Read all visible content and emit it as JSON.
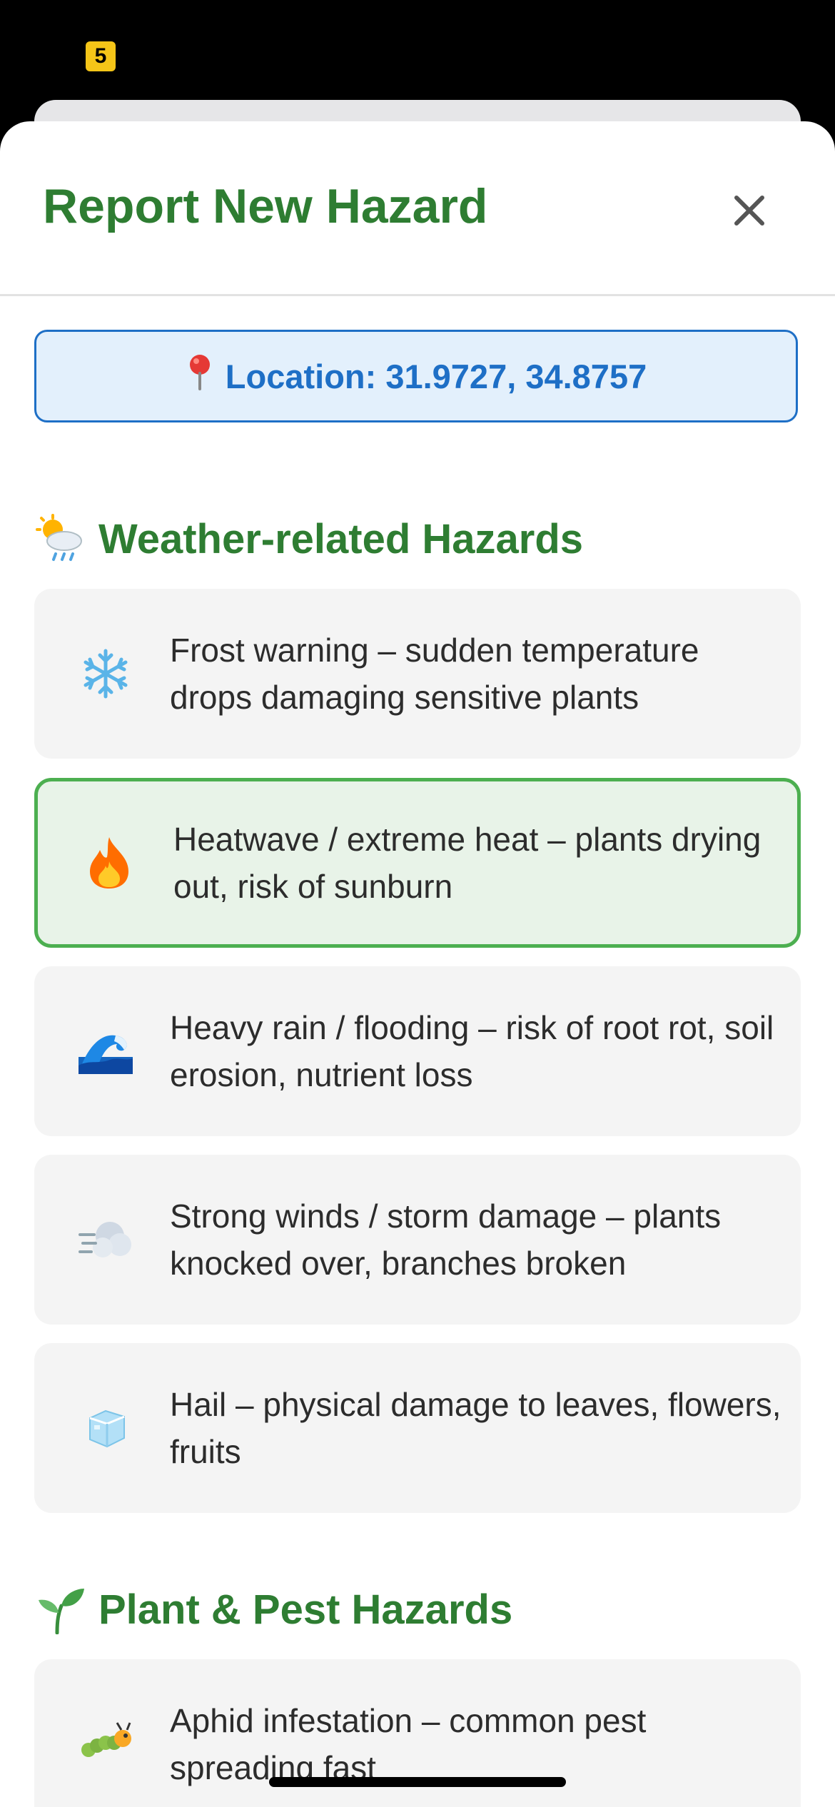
{
  "status_bar": {
    "badge": "5"
  },
  "modal": {
    "title": "Report New Hazard",
    "location_label": "Location: 31.9727, 34.8757"
  },
  "sections": [
    {
      "title": "Weather-related Hazards",
      "icon": "sun-cloud-rain-icon",
      "items": [
        {
          "icon": "snowflake-icon",
          "text": "Frost warning – sudden temperature drops damaging sensitive plants",
          "selected": false
        },
        {
          "icon": "fire-icon",
          "text": "Heatwave / extreme heat – plants drying out, risk of sunburn",
          "selected": true
        },
        {
          "icon": "wave-icon",
          "text": "Heavy rain / flooding – risk of root rot, soil erosion, nutrient loss",
          "selected": false
        },
        {
          "icon": "wind-icon",
          "text": "Strong winds / storm damage – plants knocked over, branches broken",
          "selected": false
        },
        {
          "icon": "ice-cube-icon",
          "text": "Hail – physical damage to leaves, flowers, fruits",
          "selected": false
        }
      ]
    },
    {
      "title": "Plant & Pest Hazards",
      "icon": "seedling-icon",
      "items": [
        {
          "icon": "bug-icon",
          "text": "Aphid infestation – common pest spreading fast",
          "selected": false
        }
      ]
    }
  ],
  "colors": {
    "accent_green": "#2e7d32",
    "selected_border": "#4caf50",
    "location_blue": "#1e6fc6"
  }
}
